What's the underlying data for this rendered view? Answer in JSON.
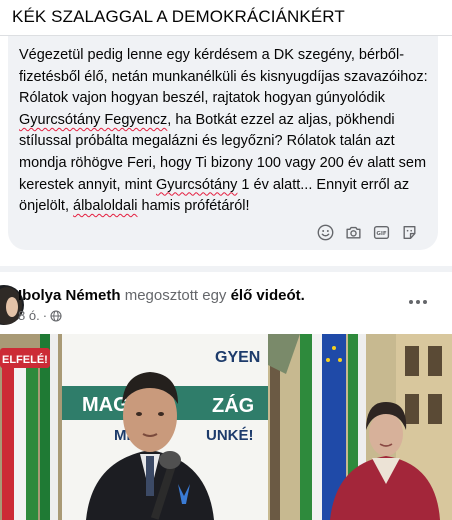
{
  "group": {
    "title": "KÉK SZALAGGAL A DEMOKRÁCIÁNKÉRT"
  },
  "comment": {
    "text_parts": {
      "p1": "Végezetül pedig lenne egy kérdésem a DK szegény, bérből-fizetésből élő, netán munkanélküli és kisnyugdíjas szavazóihoz: Rólatok vajon hogyan beszél, rajtatok hogyan gúnyolódik ",
      "s1": "Gyurcsótány Fegyencz",
      "p2": ", ha Botkát ezzel az aljas, pökhendi stílussal próbálta megalázni és legyőzni? Rólatok talán azt mondja röhögve Feri, hogy Ti bizony 100 vagy 200 év alatt sem kerestek annyit, mint ",
      "s2": "Gyurcsótány",
      "p3": " 1 év alatt... Ennyit erről az önjelölt, ",
      "s3": "álbaloldali",
      "p4": " hamis prófétáról!"
    },
    "composer_icons": [
      "emoji-icon",
      "camera-icon",
      "gif-icon",
      "sticker-icon"
    ],
    "gif_label": "GIF"
  },
  "post": {
    "author": "Ibolya Németh",
    "shared_text": "megosztott egy",
    "live_text": "élő videót.",
    "time": "8 ó.",
    "privacy_icon": "globe-icon",
    "video": {
      "banner_badge": "ELFELÉ!",
      "banner_text_1": "MAGY",
      "banner_text_2": "GYEN",
      "banner_text_3": "ZÁG",
      "banner_text_4": "MIN",
      "banner_text_5": "UNKÉ!"
    }
  },
  "colors": {
    "accent": "#1877f2",
    "spellcheck": "#e41e3f",
    "secondary_text": "#65676b",
    "bubble": "#f0f2f5"
  }
}
